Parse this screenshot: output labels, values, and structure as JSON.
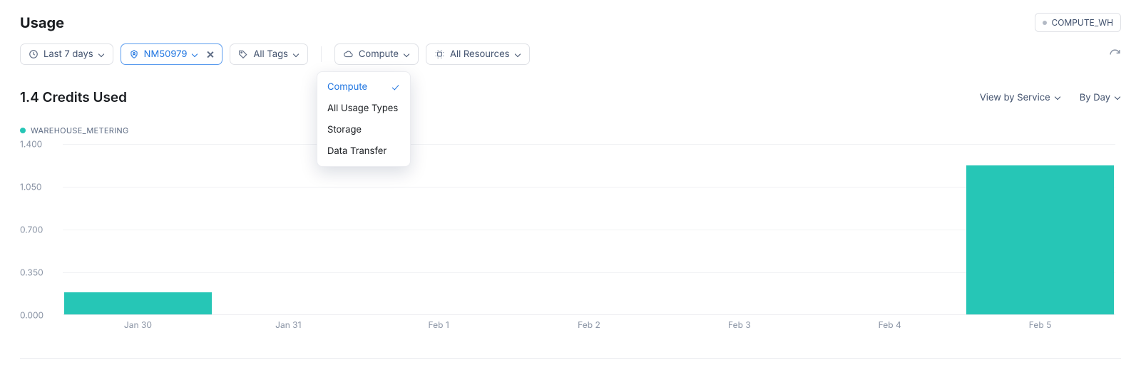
{
  "header": {
    "title": "Usage",
    "warehouse_badge": "COMPUTE_WH"
  },
  "filters": {
    "time_range": "Last 7 days",
    "user_filter": "NM50979",
    "tags": "All Tags",
    "usage_type": "Compute",
    "resources": "All Resources"
  },
  "usage_type_dropdown": {
    "items": [
      "Compute",
      "All Usage Types",
      "Storage",
      "Data Transfer"
    ],
    "selected": "Compute"
  },
  "summary": {
    "credits_used_label": "1.4 Credits Used",
    "view_by": "View by Service",
    "granularity": "By Day"
  },
  "legend": {
    "series_name": "WAREHOUSE_METERING",
    "color": "#26c6b6"
  },
  "chart_data": {
    "type": "bar",
    "title": "",
    "xlabel": "",
    "ylabel": "",
    "categories": [
      "Jan 30",
      "Jan 31",
      "Feb 1",
      "Feb 2",
      "Feb 3",
      "Feb 4",
      "Feb 5"
    ],
    "series": [
      {
        "name": "WAREHOUSE_METERING",
        "values": [
          0.18,
          0,
          0,
          0,
          0,
          0,
          1.22
        ]
      }
    ],
    "ylim": [
      0,
      1.4
    ],
    "yticks": [
      0.0,
      0.35,
      0.7,
      1.05,
      1.4
    ],
    "ytick_labels": [
      "0.000",
      "0.350",
      "0.700",
      "1.050",
      "1.400"
    ]
  }
}
